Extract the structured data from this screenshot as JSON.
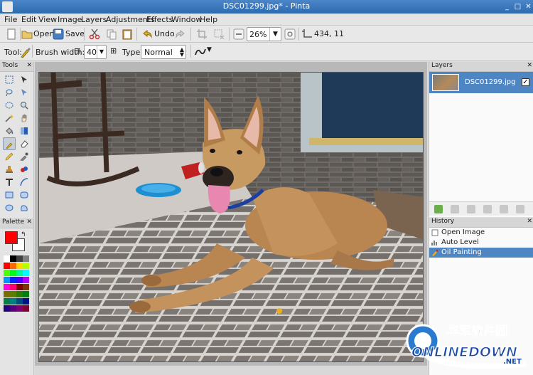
{
  "window": {
    "title": "DSC01299.jpg* - Pinta"
  },
  "menu": [
    "File",
    "Edit",
    "View",
    "Image",
    "Layers",
    "Adjustments",
    "Effects",
    "Window",
    "Help"
  ],
  "toolbar": {
    "open_label": "Open",
    "save_label": "Save",
    "undo_label": "Undo",
    "zoom_value": "26%",
    "cursor_position": "434, 11"
  },
  "tool_options": {
    "tool_label": "Tool:",
    "brush_width_label": "Brush width:",
    "brush_width_value": "40",
    "type_label": "Type:",
    "type_value": "Normal"
  },
  "panels": {
    "tools_title": "Tools",
    "palette_title": "Palette",
    "layers_title": "Layers",
    "history_title": "History"
  },
  "palette": {
    "primary_color": "#ff0000",
    "secondary_color": "#ffffff"
  },
  "layers": [
    {
      "name": "DSC01299.jpg",
      "visible": true
    }
  ],
  "history": [
    {
      "label": "Open Image",
      "selected": false
    },
    {
      "label": "Auto Level",
      "selected": false
    },
    {
      "label": "Oil Painting",
      "selected": true
    }
  ],
  "watermark": {
    "chinese": "华军软件园",
    "latin": "ONLINEDOWN",
    "suffix": ".NET"
  },
  "colors": {
    "selection": "#4e86c4",
    "titlebar": "#3a78bd"
  }
}
